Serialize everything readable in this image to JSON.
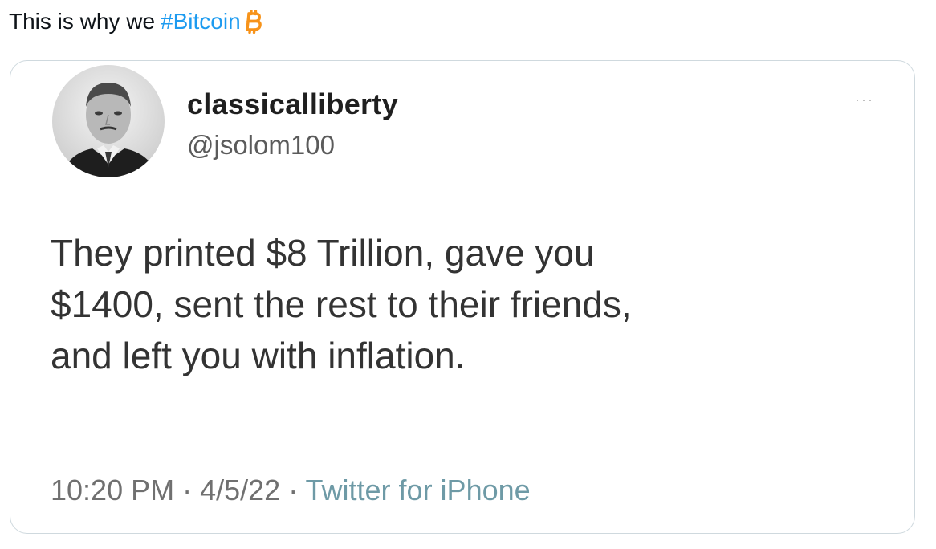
{
  "post": {
    "text_before_hashtag": "This is why we",
    "hashtag": "#Bitcoin",
    "emoji_icon": "bitcoin-icon",
    "colors": {
      "hashtag": "#1d9bf0",
      "bitcoin": "#f7931a"
    }
  },
  "quoted_tweet": {
    "display_name": "classicalliberty",
    "handle": "@jsolom100",
    "more_label": "···",
    "body_lines": [
      "They printed $8 Trillion, gave you",
      "$1400, sent the rest to their friends,",
      "and left you with inflation."
    ],
    "time": "10:20 PM",
    "separator": " · ",
    "date": "4/5/22",
    "source": "Twitter for iPhone",
    "avatar_icon": "portrait-avatar-icon",
    "colors": {
      "border": "#cfd9de",
      "source_link": "#6e9aa6"
    }
  }
}
